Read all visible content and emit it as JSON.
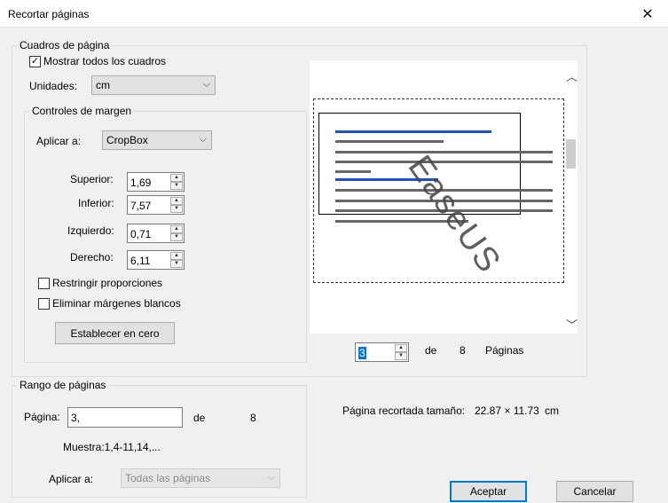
{
  "window": {
    "title": "Recortar páginas",
    "close_glyph": "✕"
  },
  "page_boxes": {
    "legend": "Cuadros de página",
    "show_all_label": "Mostrar todos los cuadros",
    "show_all_checked": true,
    "units_label": "Unidades:",
    "units_value": "cm"
  },
  "margin_controls": {
    "legend": "Controles de margen",
    "apply_label": "Aplicar a:",
    "apply_value": "CropBox",
    "top_label": "Superior:",
    "top_value": "1,69",
    "bottom_label": "Inferior:",
    "bottom_value": "7,57",
    "left_label": "Izquierdo:",
    "left_value": "0,71",
    "right_label": "Derecho:",
    "right_value": "6,11",
    "constrain_label": "Restringir proporciones",
    "constrain_checked": false,
    "remove_white_label": "Eliminar márgenes blancos",
    "remove_white_checked": false,
    "reset_label": "Establecer en cero"
  },
  "preview": {
    "page_number": "3",
    "of_label": "de",
    "total_pages": "8",
    "pages_label": "Páginas",
    "watermark": "EaseUS"
  },
  "cropped_size": {
    "label": "Página recortada tamaño:",
    "value": "22.87 × 11.73",
    "unit": "cm"
  },
  "page_range": {
    "legend": "Rango de páginas",
    "page_label": "Página:",
    "page_value": "3,",
    "of_label": "de",
    "total": "8",
    "sample": "Muestra:1,4-11,14,...",
    "apply_label": "Aplicar a:",
    "apply_value": "Todas las páginas"
  },
  "buttons": {
    "accept": "Aceptar",
    "cancel": "Cancelar"
  },
  "colors": {
    "accent": "#0078d7",
    "link_blue": "#1a4fd6"
  }
}
